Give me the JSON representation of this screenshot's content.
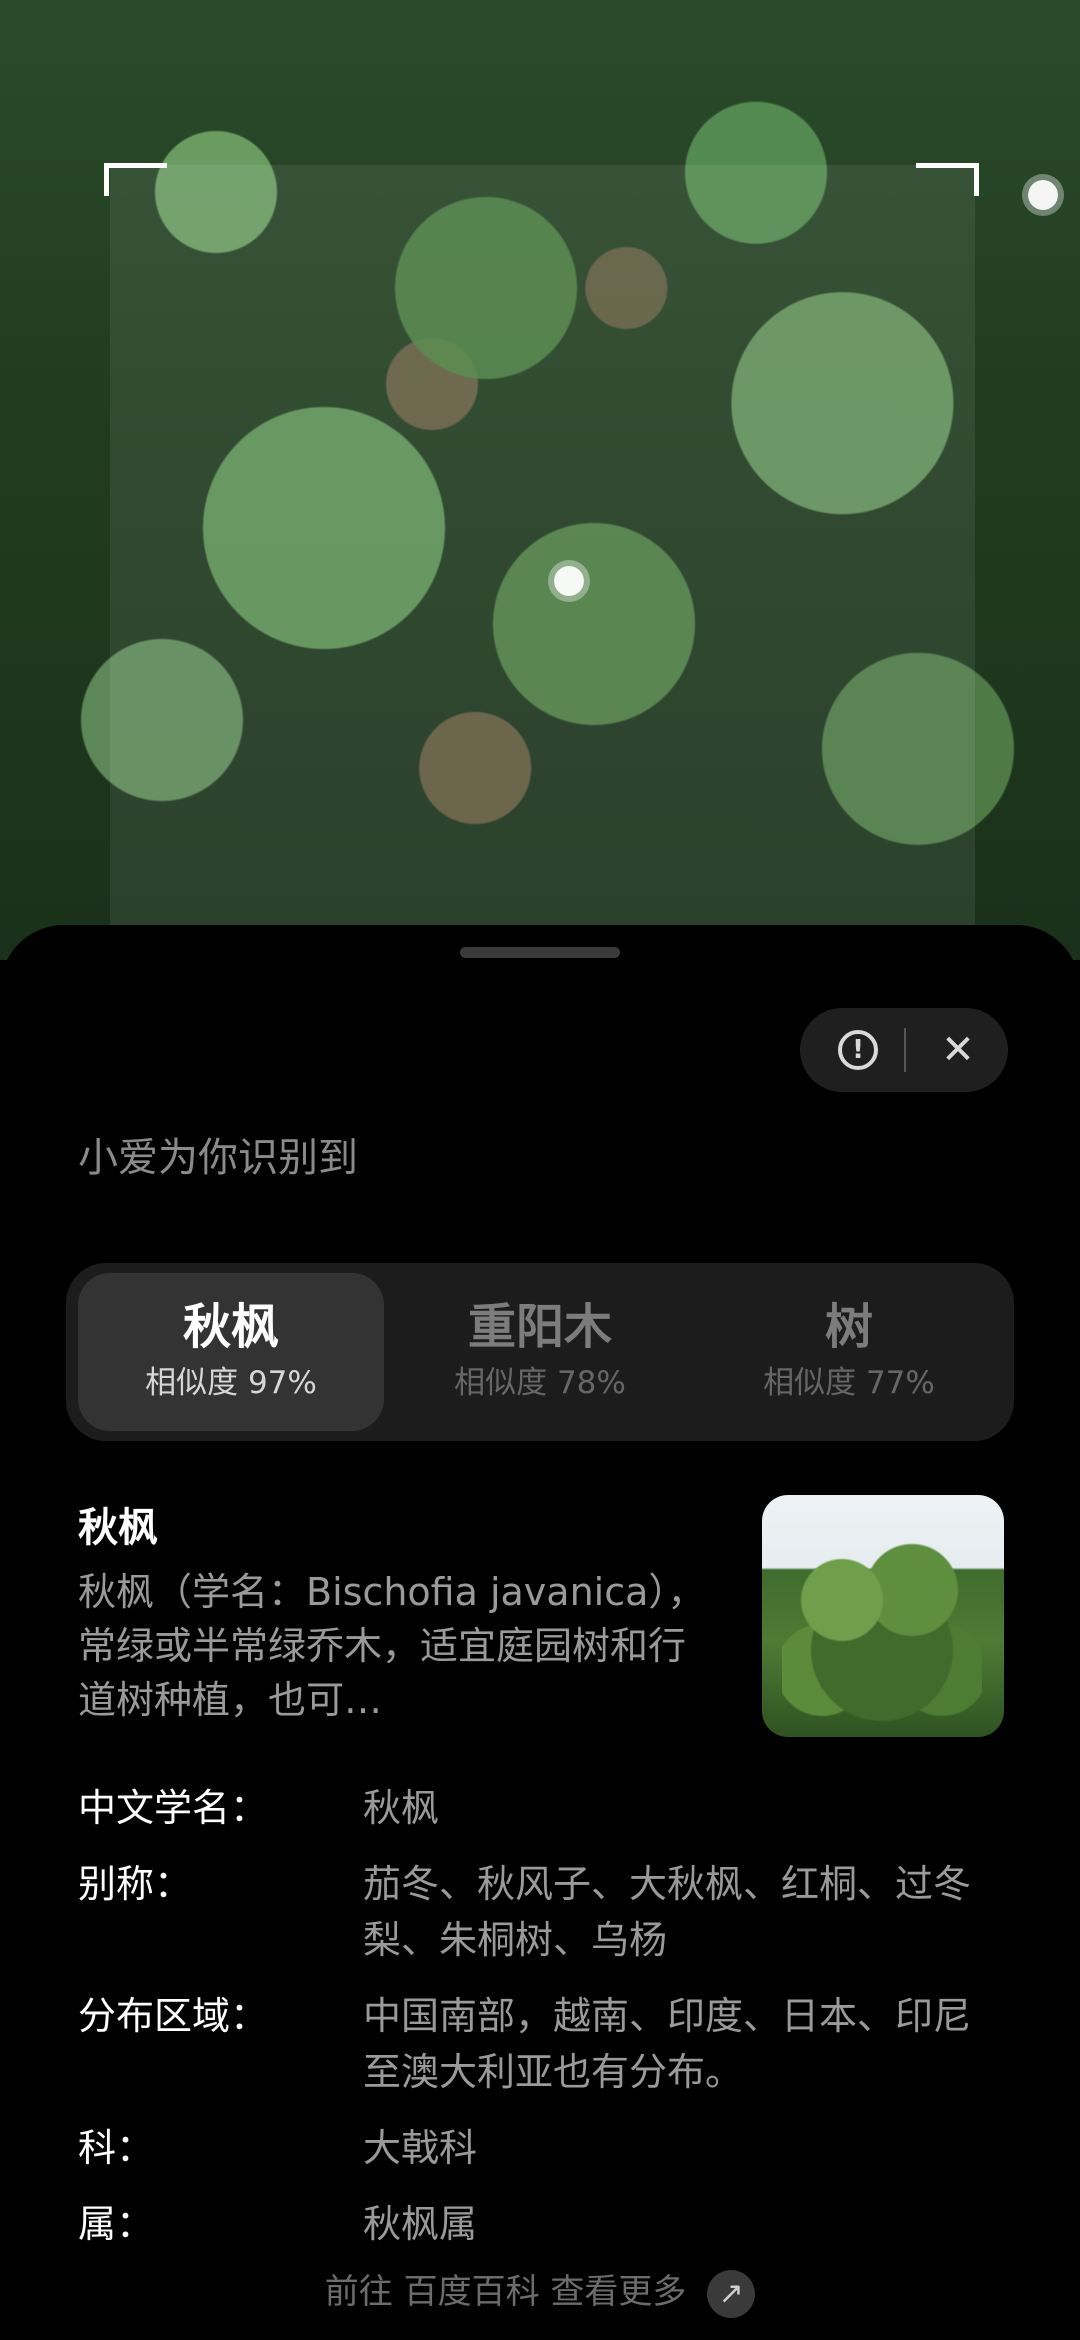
{
  "camera": {
    "scene_description": "",
    "scan_region_label": ""
  },
  "sheet": {
    "title": "小爱为你识别到",
    "actions": {
      "info_icon": "info-icon",
      "close_icon": "close-icon",
      "close_label": "✕"
    },
    "candidates": [
      {
        "name": "秋枫",
        "score": "相似度 97%"
      },
      {
        "name": "重阳木",
        "score": "相似度 78%"
      },
      {
        "name": "树",
        "score": "相似度 77%"
      }
    ],
    "detail": {
      "name": "秋枫",
      "description": "秋枫（学名：Bischofia javanica），常绿或半常绿乔木，适宜庭园树和行道树种植，也可…",
      "facts": [
        {
          "label": "中文学名：",
          "value": "秋枫"
        },
        {
          "label": "别称：",
          "value": "茄冬、秋风子、大秋枫、红桐、过冬梨、朱桐树、乌杨"
        },
        {
          "label": "分布区域：",
          "value": "中国南部，越南、印度、日本、印尼至澳大利亚也有分布。"
        },
        {
          "label": "科：",
          "value": "大戟科"
        },
        {
          "label": "属：",
          "value": "秋枫属"
        }
      ]
    },
    "more_link": "前往 百度百科 查看更多",
    "more_icon": "↗"
  },
  "colors": {
    "sheet_bg": "#000000",
    "candidate_bg": "#1c1c1c",
    "candidate_active_bg": "#333333",
    "text_primary": "#ffffff",
    "text_secondary": "#9a9a9a"
  }
}
